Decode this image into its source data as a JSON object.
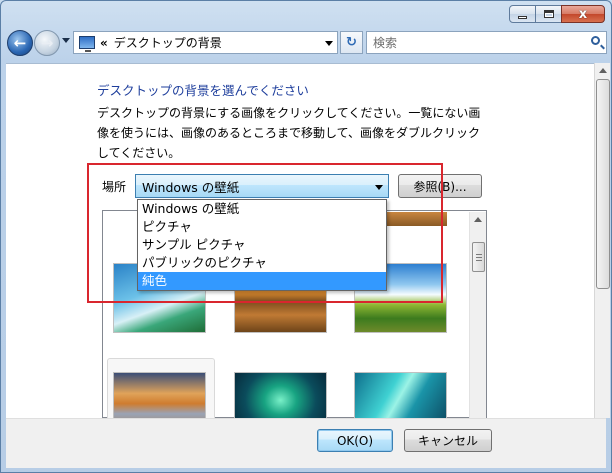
{
  "titlebar": {
    "minimize_icon": "minimize-icon",
    "maximize_icon": "maximize-icon",
    "close_label": "x"
  },
  "nav": {
    "back_glyph": "←",
    "forward_glyph": "→",
    "address_chevron": "«",
    "address_text": "デスクトップの背景",
    "refresh_glyph": "↻",
    "search_placeholder": "検索"
  },
  "main": {
    "heading": "デスクトップの背景を選んでください",
    "description": "デスクトップの背景にする画像をクリックしてください。一覧にない画像を使うには、画像のあるところまで移動して、画像をダブルクリックしてください。",
    "location_label": "場所",
    "location_value": "Windows の壁紙",
    "browse_label": "参照(B)...",
    "dropdown_options": [
      "Windows の壁紙",
      "ピクチャ",
      "サンプル ピクチャ",
      "パブリックのピクチャ",
      "純色"
    ],
    "dropdown_highlighted": "純色"
  },
  "footer": {
    "ok_label": "OK(O)",
    "cancel_label": "キャンセル"
  },
  "colors": {
    "heading": "#1e3e9c",
    "highlight": "#3399ff",
    "annotation": "#d9262e"
  }
}
